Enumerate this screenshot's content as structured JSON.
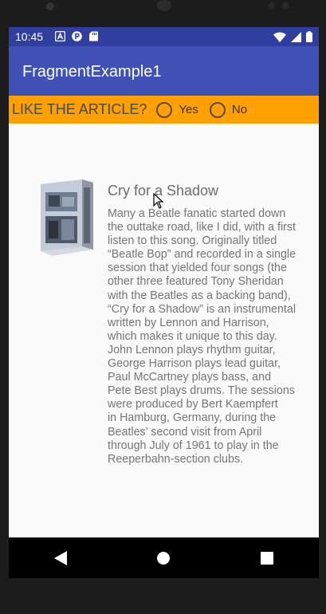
{
  "status": {
    "time": "10:45",
    "left_icons": [
      "a-notification-icon",
      "p-notification-icon",
      "sd-card-icon"
    ],
    "right_icons": [
      "wifi-icon",
      "signal-icon",
      "battery-icon"
    ]
  },
  "appbar": {
    "title": "FragmentExample1"
  },
  "rating": {
    "question": "LIKE THE ARTICLE?",
    "options": [
      "Yes",
      "No"
    ]
  },
  "article": {
    "title": "Cry for a Shadow",
    "body": "Many a Beatle fanatic started down\nthe outtake road, like I did, with a first\nlisten to this song. Originally titled\n“Beatle Bop” and recorded in a single\nsession that yielded four songs (the\nother three featured Tony Sheridan\nwith the Beatles as a backing band),\n“Cry for a Shadow” is an instrumental\nwritten by Lennon and Harrison,\nwhich makes it unique to this day.\nJohn Lennon plays rhythm guitar,\nGeorge Harrison plays lead guitar,\nPaul McCartney plays bass, and\nPete Best plays drums. The sessions\nwere produced by Bert Kaempfert\nin Hamburg, Germany, during the\nBeatles’ second visit from April\nthrough July of 1961 to play in the\nReeperbahn-section clubs."
  },
  "colors": {
    "statusbar": "#303f9f",
    "appbar": "#3f51b5",
    "likebar": "#ffa000"
  }
}
